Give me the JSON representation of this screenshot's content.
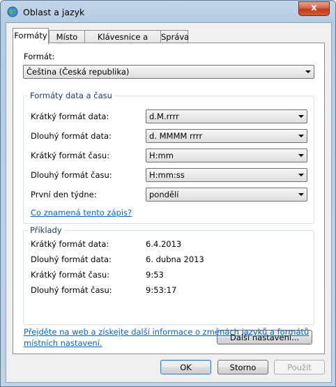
{
  "window": {
    "title": "Oblast a jazyk",
    "close_label": "x"
  },
  "tabs": [
    {
      "label": "Formáty",
      "active": true
    },
    {
      "label": "Místo",
      "active": false
    },
    {
      "label": "Klávesnice a jazyky",
      "active": false
    },
    {
      "label": "Správa",
      "active": false
    }
  ],
  "format": {
    "label": "Formát:",
    "value": "Čeština (Česká republika)"
  },
  "datetime_group": {
    "title": "Formáty data a času",
    "rows": [
      {
        "label": "Krátký formát data:",
        "value": "d.M.rrrr"
      },
      {
        "label": "Dlouhý formát data:",
        "value": "d. MMMM rrrr"
      },
      {
        "label": "Krátký formát času:",
        "value": "H:mm"
      },
      {
        "label": "Dlouhý formát času:",
        "value": "H:mm:ss"
      },
      {
        "label": "První den týdne:",
        "value": "pondělí"
      }
    ],
    "help_link": "Co znamená tento zápis?"
  },
  "examples_group": {
    "title": "Příklady",
    "rows": [
      {
        "label": "Krátký formát data:",
        "value": "6.4.2013"
      },
      {
        "label": "Dlouhý formát data:",
        "value": "6. dubna 2013"
      },
      {
        "label": "Krátký formát času:",
        "value": "9:53"
      },
      {
        "label": "Dlouhý formát času:",
        "value": "9:53:17"
      }
    ]
  },
  "more_settings_button": "Další nastavení...",
  "info_link": {
    "line1": "Přejděte na web a získejte další informace o změnách jazyků a formátů",
    "line2": "místních nastavení."
  },
  "buttons": {
    "ok": "OK",
    "cancel": "Storno",
    "apply": "Použít"
  },
  "colors": {
    "link": "#0066cc",
    "group_title": "#1e395b",
    "close_button": "#c13a1c"
  }
}
